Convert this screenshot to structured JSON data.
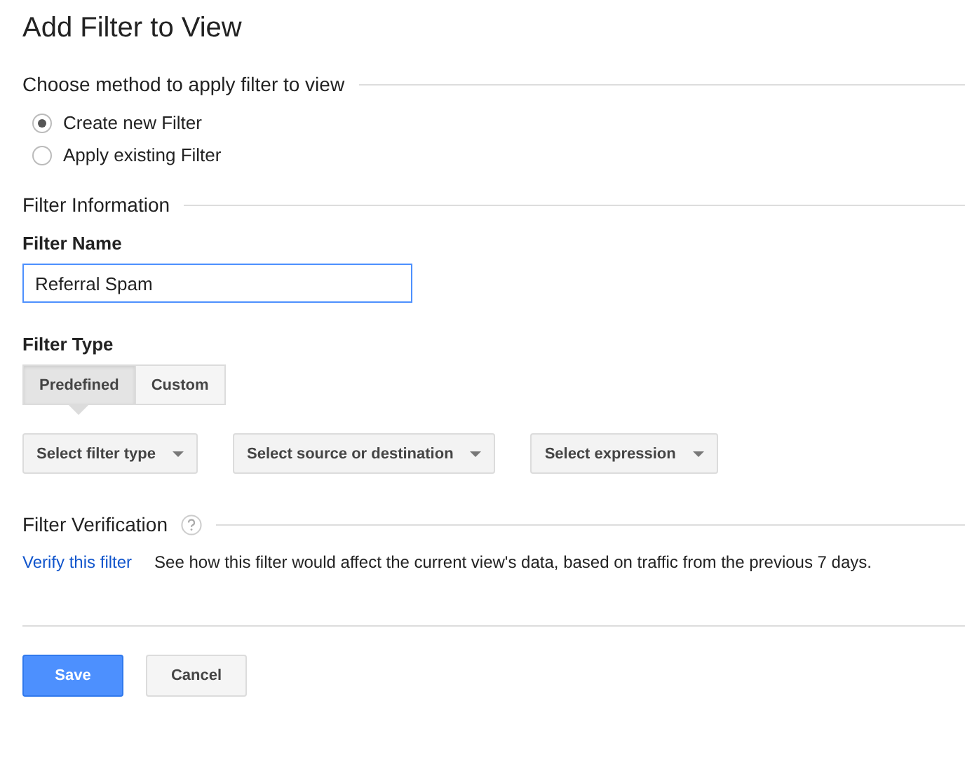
{
  "title": "Add Filter to View",
  "method": {
    "heading": "Choose method to apply filter to view",
    "options": [
      {
        "label": "Create new Filter",
        "selected": true
      },
      {
        "label": "Apply existing Filter",
        "selected": false
      }
    ]
  },
  "info": {
    "heading": "Filter Information",
    "name_label": "Filter Name",
    "name_value": "Referral Spam",
    "type_label": "Filter Type",
    "tabs": [
      {
        "label": "Predefined",
        "selected": true
      },
      {
        "label": "Custom",
        "selected": false
      }
    ],
    "dropdowns": [
      "Select filter type",
      "Select source or destination",
      "Select expression"
    ]
  },
  "verification": {
    "heading": "Filter Verification",
    "link": "Verify this filter",
    "description": "See how this filter would affect the current view's data, based on traffic from the previous 7 days."
  },
  "buttons": [
    {
      "label": "Save",
      "kind": "primary"
    },
    {
      "label": "Cancel",
      "kind": "secondary"
    }
  ]
}
